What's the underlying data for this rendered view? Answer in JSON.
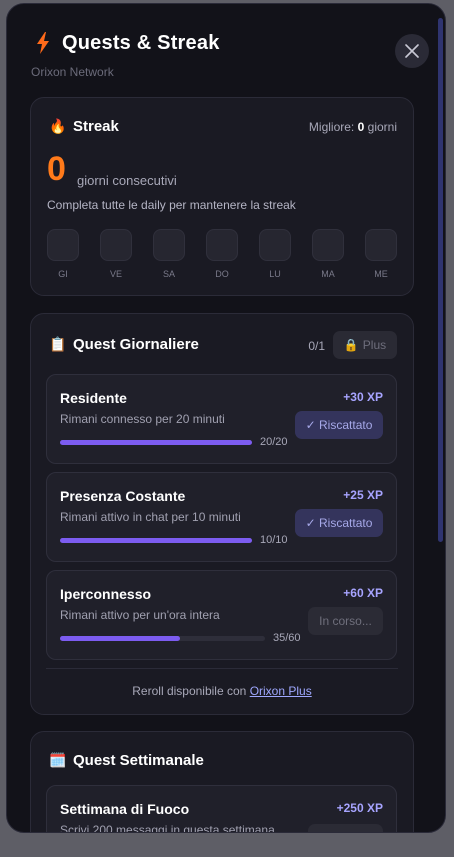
{
  "modal": {
    "title": "Quests & Streak",
    "subtitle": "Orixon Network",
    "close_icon": "close-icon"
  },
  "streak": {
    "title": "Streak",
    "best_label": "Migliore:",
    "best_value": "0",
    "best_unit": "giorni",
    "current": "0",
    "current_unit": "giorni consecutivi",
    "hint": "Completa tutte le daily per mantenere la streak",
    "days": [
      "GI",
      "VE",
      "SA",
      "DO",
      "LU",
      "MA",
      "ME"
    ]
  },
  "daily": {
    "title": "Quest Giornaliere",
    "count": "0/1",
    "plus_label": "Plus",
    "quests": [
      {
        "name": "Residente",
        "desc": "Rimani connesso per 20 minuti",
        "xp": "+30 XP",
        "progress": "20/20",
        "fraction": 1.0,
        "status": "✓ Riscattato"
      },
      {
        "name": "Presenza Costante",
        "desc": "Rimani attivo in chat per 10 minuti",
        "xp": "+25 XP",
        "progress": "10/10",
        "fraction": 1.0,
        "status": "✓ Riscattato"
      },
      {
        "name": "Iperconnesso",
        "desc": "Rimani attivo per un'ora intera",
        "xp": "+60 XP",
        "progress": "35/60",
        "fraction": 0.583,
        "status": "In corso..."
      }
    ],
    "reroll_text": "Reroll disponibile con",
    "reroll_link": "Orixon Plus"
  },
  "weekly": {
    "title": "Quest Settimanale",
    "quests": [
      {
        "name": "Settimana di Fuoco",
        "desc": "Scrivi 200 messaggi in questa settimana",
        "xp": "+250 XP"
      }
    ]
  },
  "colors": {
    "accent": "#7c5cf0",
    "streak": "#ff7a1a",
    "xp": "#a7a4ff"
  }
}
